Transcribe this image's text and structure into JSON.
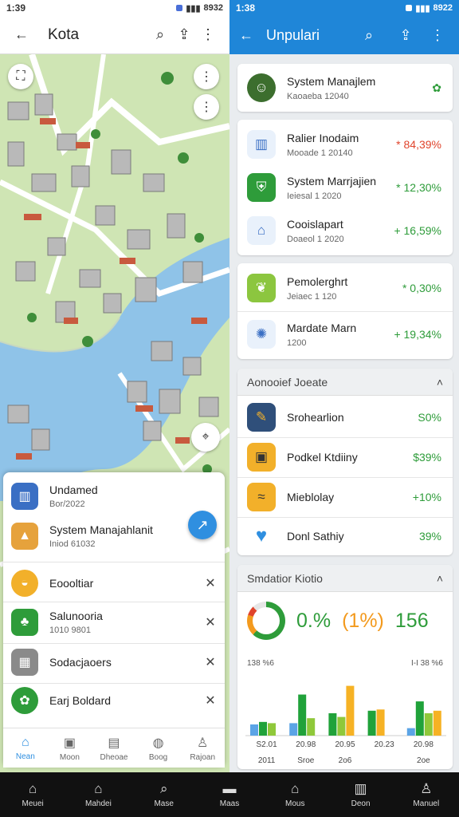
{
  "status_left": {
    "time": "1:39"
  },
  "status_right": {
    "time": "1:38",
    "battery": "8922"
  },
  "status_left_battery": "8932",
  "left": {
    "title": "Kota",
    "sheet_items": [
      {
        "title": "Undamed",
        "subtitle": "Bor/2022"
      },
      {
        "title": "System Manajahlanit",
        "subtitle": "Iniod 61032"
      },
      {
        "title": "Eoooltiar"
      },
      {
        "title": "Salunooria",
        "subtitle": "1010 9801"
      },
      {
        "title": "Sodacjaoers"
      },
      {
        "title": "Earj Boldard"
      }
    ],
    "nav": [
      {
        "label": "Nean",
        "icon": "⌂",
        "active": true
      },
      {
        "label": "Moon",
        "icon": "▣"
      },
      {
        "label": "Dheoae",
        "icon": "▤"
      },
      {
        "label": "Boog",
        "icon": "◍"
      },
      {
        "label": "Rajoan",
        "icon": "♙"
      }
    ]
  },
  "right": {
    "title": "Unpulari",
    "profile": {
      "title": "System Manajlem",
      "subtitle": "Kaoaeba 12040"
    },
    "list1": [
      {
        "title": "Ralier Inodaim",
        "subtitle": "Mooade 1 20140",
        "value": "* 84,39%",
        "neg": true
      },
      {
        "title": "System Marrjajien",
        "subtitle": "Ieiesal 1 2020",
        "value": "* 12,30%"
      },
      {
        "title": "Cooislapart",
        "subtitle": "Doaeol 1 2020",
        "value": "+ 16,59%"
      }
    ],
    "list2": [
      {
        "title": "Pemolerghrt",
        "subtitle": "Jeiaec 1 120",
        "value": "* 0,30%"
      },
      {
        "title": "Mardate Marn",
        "subtitle": "1200",
        "value": "+ 19,34%"
      }
    ],
    "section1": {
      "header": "Aonooief Joeate",
      "items": [
        {
          "title": "Srohearlion",
          "value": "S0%"
        },
        {
          "title": "Podkel Ktdiiny",
          "value": "$39%"
        },
        {
          "title": "Mieblolay",
          "value": "+10%"
        },
        {
          "title": "Donl Sathiy",
          "value": "39%"
        }
      ]
    },
    "section2": {
      "header": "Smdatior Kiotio",
      "stat1": "0.%",
      "stat2": "(1%)",
      "stat3": "156",
      "tick_left": "138 %6",
      "tick_right": "I-I 38 %6"
    }
  },
  "chart_data": {
    "type": "bar",
    "categories": [
      "S2.01",
      "20.98",
      "20.95",
      "20.23",
      "20.98"
    ],
    "xlabels_bottom": [
      "2011",
      "Sroe",
      "2o6",
      "",
      "2oe"
    ],
    "series": [
      {
        "color": "#5ba4e6",
        "values": [
          18,
          20,
          0,
          0,
          12
        ]
      },
      {
        "color": "#20a23a",
        "values": [
          22,
          66,
          36,
          40,
          55
        ]
      },
      {
        "color": "#8fc83a",
        "values": [
          20,
          28,
          30,
          0,
          36
        ]
      },
      {
        "color": "#f6b224",
        "values": [
          0,
          0,
          80,
          42,
          40
        ]
      }
    ],
    "ylim": [
      0,
      100
    ]
  },
  "bottom_nav": [
    {
      "label": "Meuei",
      "icon": "⌂"
    },
    {
      "label": "Mahdei",
      "icon": "⌂"
    },
    {
      "label": "Mase",
      "icon": "⌕"
    },
    {
      "label": "Maas",
      "icon": "▬"
    },
    {
      "label": "Mous",
      "icon": "⌂"
    },
    {
      "label": "Deon",
      "icon": "▥"
    },
    {
      "label": "Manuel",
      "icon": "♙"
    }
  ]
}
